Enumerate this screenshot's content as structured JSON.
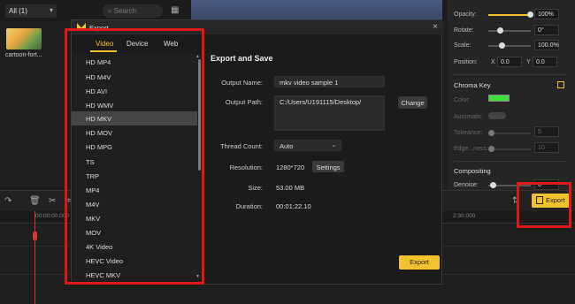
{
  "app": {
    "media_filter": "All (1)",
    "search_placeholder": "Search",
    "media_item_name": "cartoon-fort..."
  },
  "properties": {
    "opacity_label": "Opacity:",
    "opacity_value": "100%",
    "rotate_label": "Rotate:",
    "rotate_value": "0°",
    "scale_label": "Scale:",
    "scale_value": "100.0%",
    "position_label": "Position:",
    "pos_x_label": "X",
    "pos_x_value": "0.0",
    "pos_y_label": "Y",
    "pos_y_value": "0.0",
    "chroma_key_label": "Chroma Key",
    "color_label": "Color:",
    "automatic_label": "Automatic:",
    "tolerance_label": "Tolerance:",
    "tolerance_value": "5",
    "edge_noise_label": "Edge...ness:",
    "edge_noise_value": "10",
    "compositing_label": "Compositing",
    "denoise_label": "Denoise:",
    "denoise_value": "0",
    "accent_color": "#f2c12e",
    "chroma_color": "#3be03b"
  },
  "timeline": {
    "ruler_start": "00:00:00.000",
    "ruler_mid": "00:00:00",
    "ruler_end": "2:30.000",
    "export_button": "Export"
  },
  "dialog": {
    "title": "Export",
    "tabs": [
      {
        "label": "Video"
      },
      {
        "label": "Device"
      },
      {
        "label": "Web"
      }
    ],
    "formats": [
      "HD MP4",
      "HD M4V",
      "HD AVI",
      "HD WMV",
      "HD MKV",
      "HD MOV",
      "HD MPG",
      "TS",
      "TRP",
      "MP4",
      "M4V",
      "MKV",
      "MOV",
      "4K Video",
      "HEVC Video",
      "HEVC MKV"
    ],
    "selected_format": "HD MKV",
    "save_title": "Export and Save",
    "output_name_label": "Output Name:",
    "output_name_value": "mkv video sample 1",
    "output_path_label": "Output Path:",
    "output_path_value": "C:/Users/U191115/Desktop/",
    "change_button": "Change",
    "thread_count_label": "Thread Count:",
    "thread_count_value": "Auto",
    "resolution_label": "Resolution:",
    "resolution_value": "1280*720",
    "settings_button": "Settings",
    "size_label": "Size:",
    "size_value": "53.00 MB",
    "duration_label": "Duration:",
    "duration_value": "00:01:22.10",
    "export_button": "Export"
  }
}
